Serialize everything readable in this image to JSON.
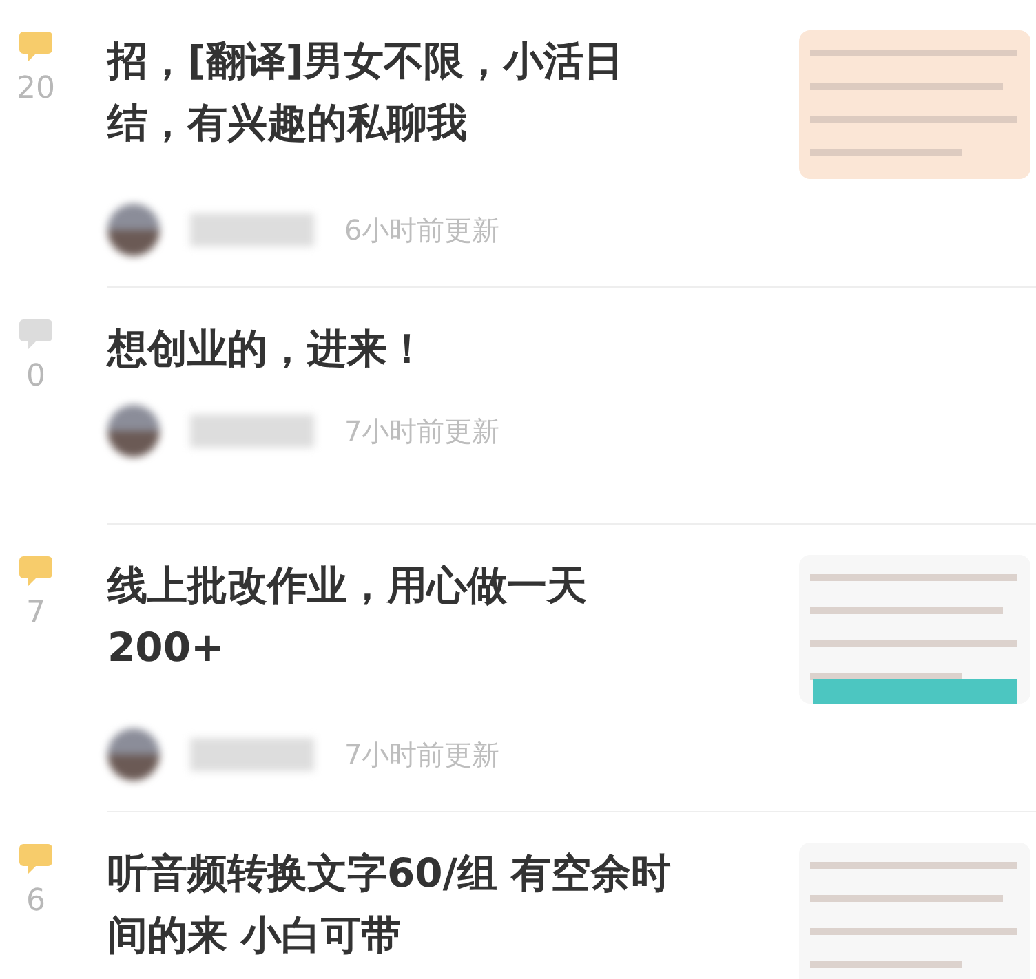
{
  "posts": [
    {
      "comment_count": "20",
      "has_comments": true,
      "title": "招，[翻译]男女不限，小活日结，有兴趣的私聊我",
      "updated": "6小时前更新"
    },
    {
      "comment_count": "0",
      "has_comments": false,
      "title": "想创业的，进来！",
      "updated": "7小时前更新"
    },
    {
      "comment_count": "7",
      "has_comments": true,
      "title": "线上批改作业，用心做一天200+",
      "updated": "7小时前更新"
    },
    {
      "comment_count": "6",
      "has_comments": true,
      "title": "听音频转换文字60/组 有空余时间的来 小白可带"
    }
  ]
}
